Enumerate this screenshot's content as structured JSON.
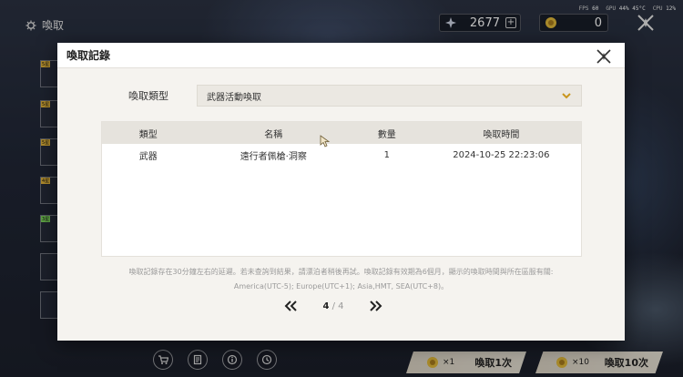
{
  "app": {
    "title": "喚取"
  },
  "perf": {
    "fps_label": "FPS",
    "fps_value": "60",
    "gpu_label": "GPU",
    "gpu_value": "44% 45°C",
    "cpu_label": "CPU",
    "cpu_value": "12%"
  },
  "currencies": [
    {
      "icon": "star-crystal-icon",
      "value": "2677",
      "plus": "+"
    },
    {
      "icon": "coin-icon",
      "value": "0"
    }
  ],
  "side_tags": [
    "5星",
    "5星",
    "5星",
    "4星",
    "3星"
  ],
  "modal": {
    "title": "喚取記錄",
    "filter_label": "喚取類型",
    "filter_selected": "武器活動喚取",
    "table": {
      "headers": [
        "類型",
        "名稱",
        "數量",
        "喚取時間"
      ],
      "rows": [
        [
          "武器",
          "遠行者佩槍·洞察",
          "1",
          "2024-10-25 22:23:06"
        ]
      ]
    },
    "note_line1": "喚取記錄存在30分鐘左右的延遲。若未查詢到結果，請漂泊者稍後再試。喚取記錄有效期為6個月，顯示的喚取時間與所在區服有關:",
    "note_line2": "America(UTC-5); Europe(UTC+1); Asia,HMT, SEA(UTC+8)。",
    "pager": {
      "prev": "«",
      "current": "4",
      "separator": "/",
      "total": "4",
      "next": "»"
    }
  },
  "bottom": {
    "pull_one": {
      "mult": "×1",
      "label": "喚取1次"
    },
    "pull_ten": {
      "mult": "×10",
      "label": "喚取10次"
    }
  },
  "colors": {
    "accent_gold": "#e0b83a",
    "modal_bg": "#f5f3ef",
    "header_row": "#e6e3dd"
  }
}
